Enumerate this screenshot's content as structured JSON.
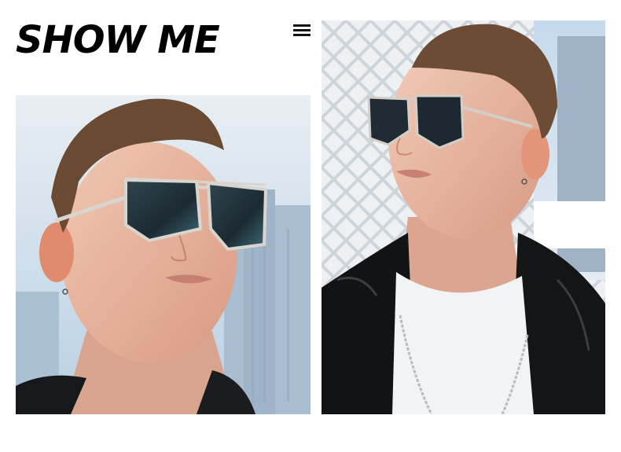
{
  "header": {
    "title": "SHOW ME"
  },
  "menu": {
    "icon": "hamburger-menu-icon"
  },
  "photos": [
    {
      "subject": "model-wearing-sunglasses-close-up",
      "colors": {
        "sky": "#c9dced",
        "skin": "#e9b6a0",
        "hair": "#6b4a33",
        "lens": "#233640",
        "frame": "#d8d5cf"
      }
    },
    {
      "subject": "model-wearing-sunglasses-leather-jacket",
      "colors": {
        "wall": "#d8dde3",
        "skin": "#eab8a2",
        "hair": "#6d4c36",
        "jacket": "#111214",
        "tshirt": "#f2f3f4"
      }
    }
  ]
}
